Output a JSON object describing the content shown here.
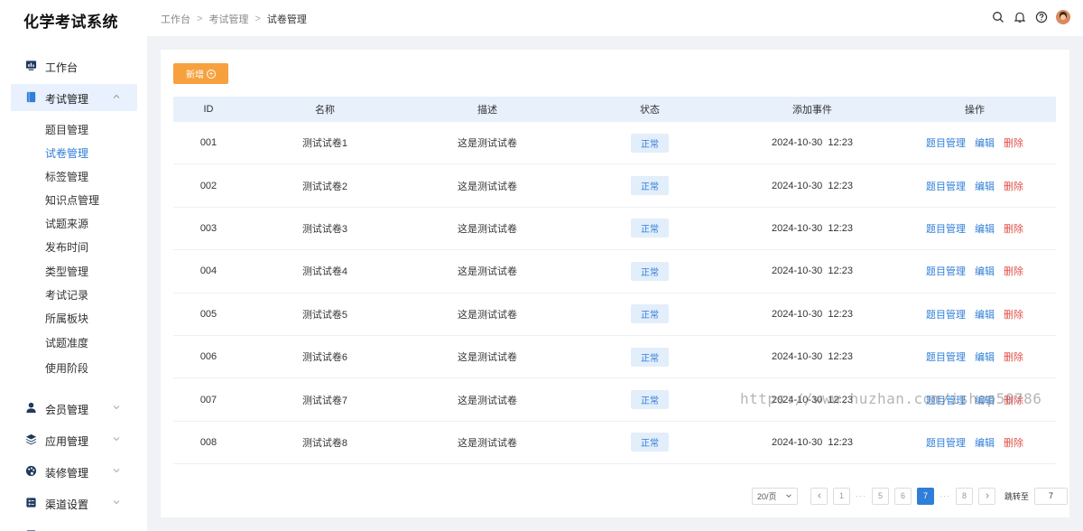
{
  "app": {
    "title": "化学考试系统"
  },
  "sidebar": {
    "groups": [
      {
        "label": "工作台",
        "icon": "monitor-chart-icon"
      },
      {
        "label": "考试管理",
        "icon": "book-icon",
        "expanded": true
      },
      {
        "label": "会员管理",
        "icon": "user-icon"
      },
      {
        "label": "应用管理",
        "icon": "layers-icon"
      },
      {
        "label": "装修管理",
        "icon": "palette-icon"
      },
      {
        "label": "渠道设置",
        "icon": "channel-icon"
      }
    ],
    "sub_items": [
      "题目管理",
      "试卷管理",
      "标签管理",
      "知识点管理",
      "试题来源",
      "发布时间",
      "类型管理",
      "考试记录",
      "所属板块",
      "试题准度",
      "使用阶段"
    ],
    "active_sub": "试卷管理"
  },
  "breadcrumb": [
    "工作台",
    "考试管理",
    "试卷管理"
  ],
  "header_icons": [
    "search-icon",
    "bell-icon",
    "help-icon",
    "avatar"
  ],
  "toolbar": {
    "add_label": "新增"
  },
  "table": {
    "columns": [
      "ID",
      "名称",
      "描述",
      "状态",
      "添加事件",
      "操作"
    ],
    "rows": [
      {
        "id": "001",
        "name": "测试试卷1",
        "desc": "这是测试试卷",
        "status": "正常",
        "time": "2024-10-30  12:23"
      },
      {
        "id": "002",
        "name": "测试试卷2",
        "desc": "这是测试试卷",
        "status": "正常",
        "time": "2024-10-30  12:23"
      },
      {
        "id": "003",
        "name": "测试试卷3",
        "desc": "这是测试试卷",
        "status": "正常",
        "time": "2024-10-30  12:23"
      },
      {
        "id": "004",
        "name": "测试试卷4",
        "desc": "这是测试试卷",
        "status": "正常",
        "time": "2024-10-30  12:23"
      },
      {
        "id": "005",
        "name": "测试试卷5",
        "desc": "这是测试试卷",
        "status": "正常",
        "time": "2024-10-30  12:23"
      },
      {
        "id": "006",
        "name": "测试试卷6",
        "desc": "这是测试试卷",
        "status": "正常",
        "time": "2024-10-30  12:23"
      },
      {
        "id": "007",
        "name": "测试试卷7",
        "desc": "这是测试试卷",
        "status": "正常",
        "time": "2024-10-30  12:23"
      },
      {
        "id": "008",
        "name": "测试试卷8",
        "desc": "这是测试试卷",
        "status": "正常",
        "time": "2024-10-30  12:23"
      }
    ],
    "ops": {
      "manage": "题目管理",
      "edit": "编辑",
      "delete": "删除"
    }
  },
  "pagination": {
    "page_size": "20/页",
    "pages": [
      "1",
      "5",
      "6",
      "7",
      "8"
    ],
    "current": "7",
    "jump_label": "跳转至",
    "jump_value": "7"
  },
  "watermark": "https://www.huzhan.com/ishop50786",
  "colors": {
    "primary": "#2f7ed8",
    "add_button": "#f7a13e",
    "danger": "#e0504a",
    "header_bg": "#e8f0fb"
  }
}
